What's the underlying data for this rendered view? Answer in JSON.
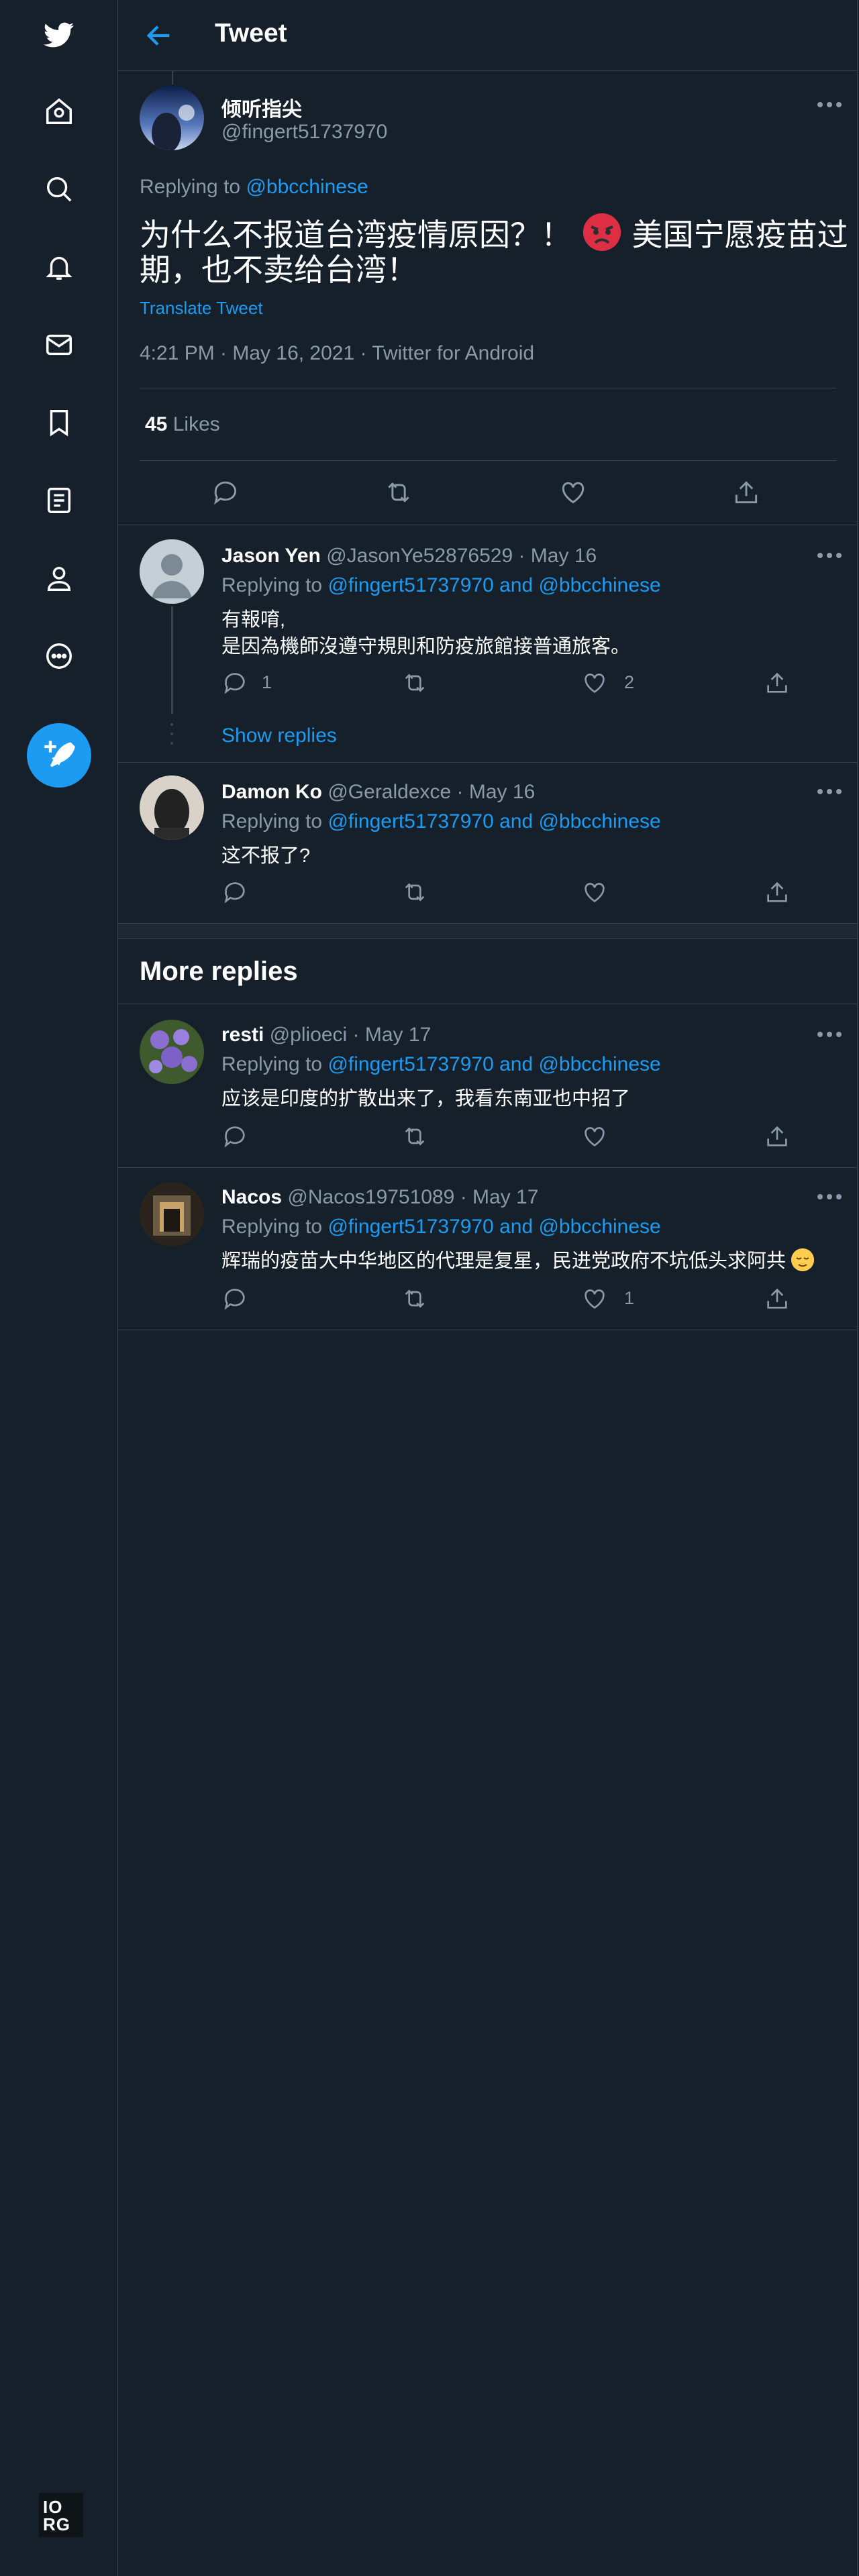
{
  "app": {
    "name": "Twitter",
    "colors": {
      "background": "#15202b",
      "accent": "#1d9bf0",
      "border": "#38444d",
      "muted": "#8b98a5"
    }
  },
  "sidebar": {
    "icons": [
      "twitter-logo-icon",
      "home-icon",
      "explore-icon",
      "notifications-icon",
      "messages-icon",
      "bookmarks-icon",
      "lists-icon",
      "profile-icon",
      "more-icon"
    ],
    "compose_icon": "compose-tweet-icon",
    "footer_logo": "IO RG"
  },
  "header": {
    "title": "Tweet",
    "back_icon": "back-arrow-icon"
  },
  "main_tweet": {
    "display_name": "倾听指尖",
    "handle": "@fingert51737970",
    "replying_prefix": "Replying to",
    "replying_to": "@bbcchinese",
    "text_part1": "为什么不报道台湾疫情原因？！",
    "text_part2": "美国宁愿疫苗过",
    "text_line2": "期，也不卖给台湾！",
    "emoji": "angry-face",
    "translate": "Translate Tweet",
    "timestamp": "4:21 PM · May 16, 2021 · Twitter for Android",
    "likes_count": "45",
    "likes_label": "Likes"
  },
  "replies": [
    {
      "display_name": "Jason Yen",
      "meta": "@JasonYe52876529 · May 16",
      "replying_prefix": "Replying to",
      "replying_to": "@fingert51737970 and @bbcchinese",
      "text_line1": "有報唷,",
      "text_line2": "是因為機師沒遵守規則和防疫旅館接普通旅客。",
      "reply_count": "1",
      "like_count": "2",
      "show_replies": "Show replies"
    },
    {
      "display_name": "Damon Ko",
      "meta": "@Geraldexce · May 16",
      "replying_prefix": "Replying to",
      "replying_to": "@fingert51737970 and @bbcchinese",
      "text_line1": "这不报了?"
    }
  ],
  "more_replies": {
    "heading": "More replies",
    "items": [
      {
        "display_name": "resti",
        "meta": "@plioeci · May 17",
        "replying_prefix": "Replying to",
        "replying_to": "@fingert51737970 and @bbcchinese",
        "text_line1": "应该是印度的扩散出来了，我看东南亚也中招了"
      },
      {
        "display_name": "Nacos",
        "meta": "@Nacos19751089 · May 17",
        "replying_prefix": "Replying to",
        "replying_to": "@fingert51737970 and @bbcchinese",
        "text_line1": "辉瑞的疫苗大中华地区的代理是复星，民进党政府不坑低头求阿共",
        "emoji": "relieved-face",
        "like_count": "1"
      }
    ]
  }
}
